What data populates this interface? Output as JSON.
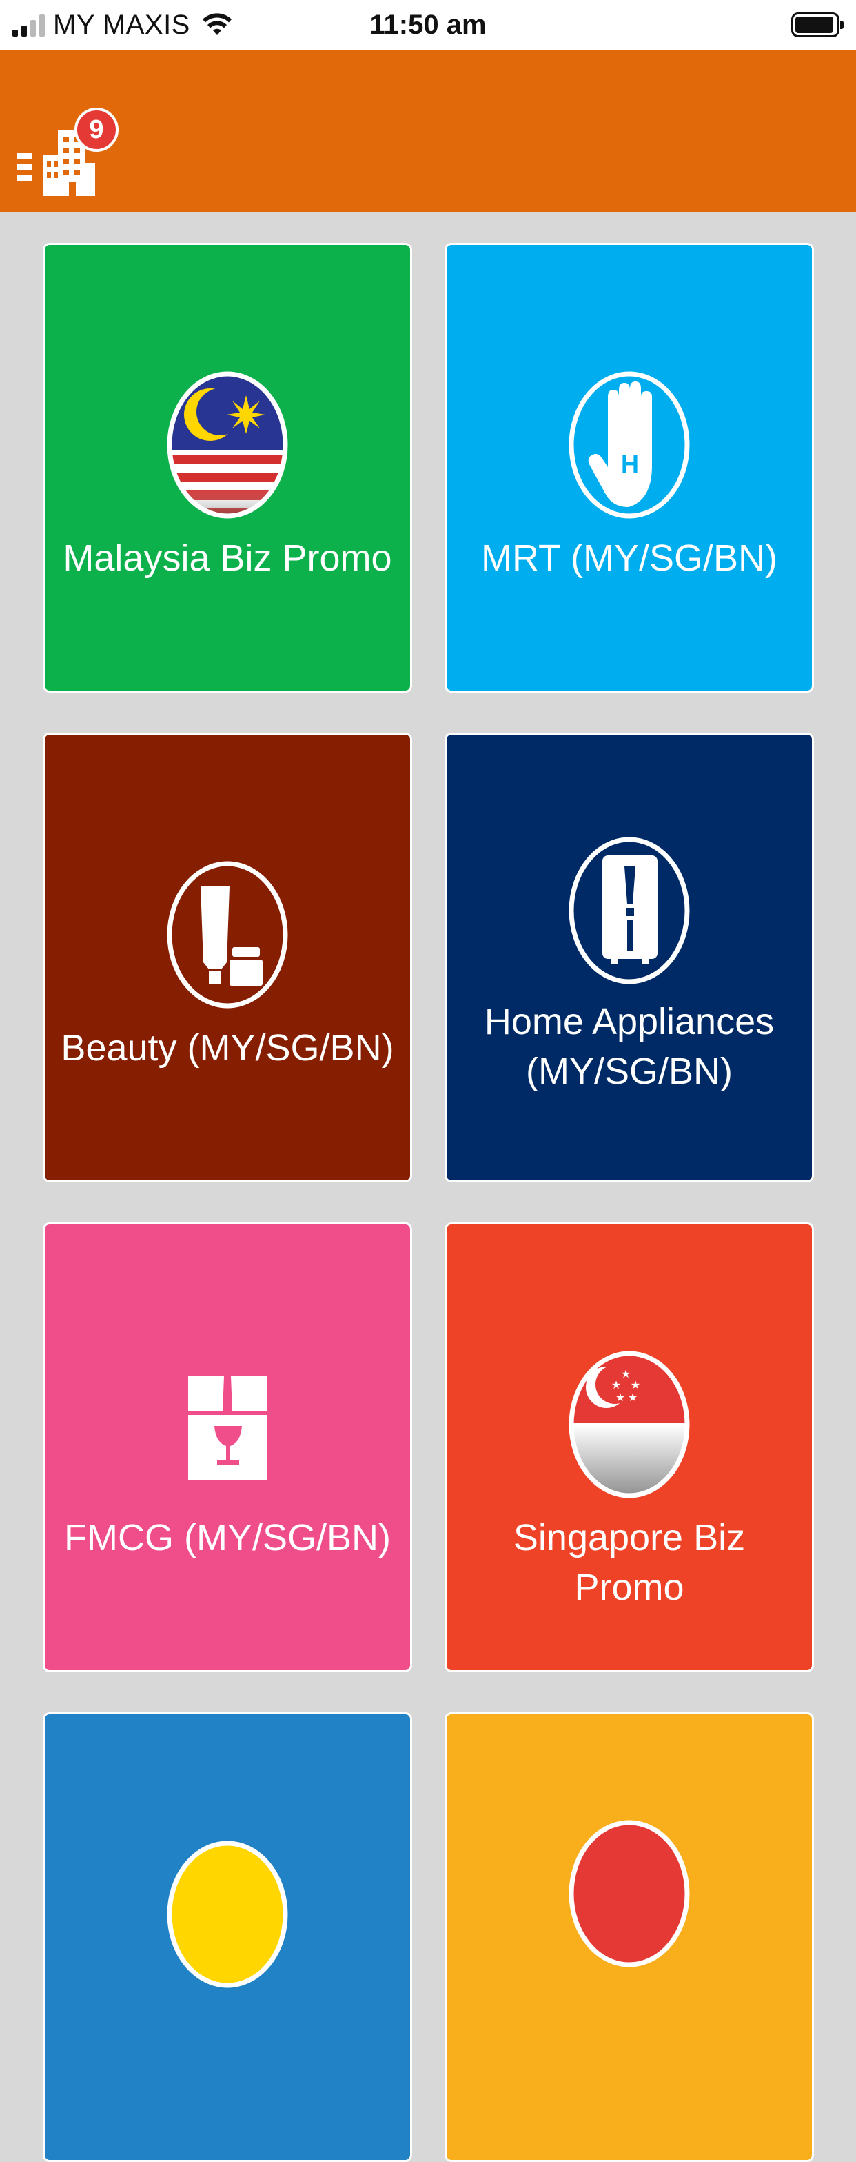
{
  "status_bar": {
    "carrier": "MY MAXIS",
    "time": "11:50 am"
  },
  "header": {
    "notification_count": "9",
    "color": "#e2690a"
  },
  "tiles": [
    {
      "label": "Malaysia Biz Promo",
      "color": "#0db14b",
      "icon": "malaysia-flag-icon"
    },
    {
      "label": "MRT (MY/SG/BN)",
      "color": "#00aeef",
      "icon": "hand-h-icon"
    },
    {
      "label": "Beauty (MY/SG/BN)",
      "color": "#861f01",
      "icon": "cosmetics-icon"
    },
    {
      "label_line1": "Home Appliances",
      "label_line2": "(MY/SG/BN)",
      "color": "#002a65",
      "icon": "refrigerator-icon"
    },
    {
      "label": "FMCG (MY/SG/BN)",
      "color": "#f04e8b",
      "icon": "wine-box-icon"
    },
    {
      "label": "Singapore Biz Promo",
      "color": "#ee4326",
      "icon": "singapore-flag-icon"
    },
    {
      "label": "",
      "color": "#2182c6",
      "icon": "partial-icon"
    },
    {
      "label": "",
      "color": "#f9ae1c",
      "icon": "partial-icon"
    }
  ]
}
